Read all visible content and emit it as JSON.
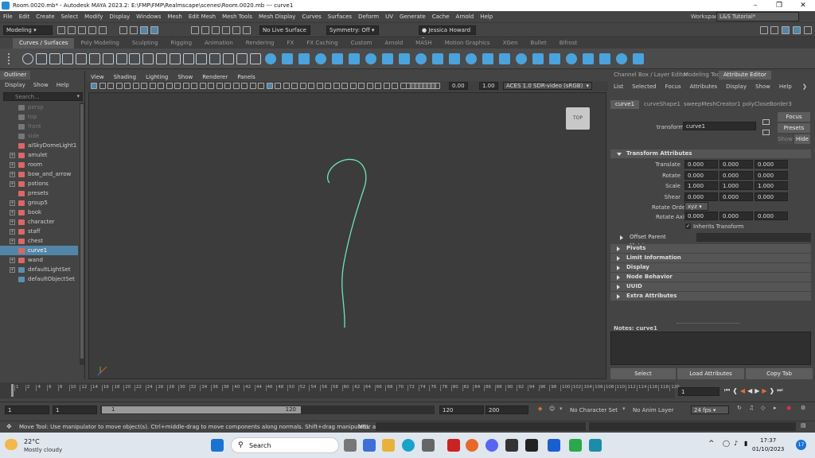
{
  "window": {
    "title": "Room.0020.mb* - Autodesk MAYA 2023.2: E:\\FMP\\FMP\\Realmscape\\scenes\\Room.0020.mb  ---  curve1"
  },
  "menubar": {
    "items": [
      "File",
      "Edit",
      "Create",
      "Select",
      "Modify",
      "Display",
      "Windows",
      "Mesh",
      "Edit Mesh",
      "Mesh Tools",
      "Mesh Display",
      "Curves",
      "Surfaces",
      "Deform",
      "UV",
      "Generate",
      "Cache",
      "Arnold",
      "Help"
    ],
    "workspace_label": "Workspace:",
    "workspace_value": "L&S Tutorial*"
  },
  "statusline": {
    "mode": "Modeling",
    "live_surface": "No Live Surface",
    "symmetry": "Symmetry: Off",
    "user": "Jessica Howard"
  },
  "shelf_tabs": [
    "Curves / Surfaces",
    "Poly Modeling",
    "Sculpting",
    "Rigging",
    "Animation",
    "Rendering",
    "FX",
    "FX Caching",
    "Custom",
    "Arnold",
    "MASH",
    "Motion Graphics",
    "XGen",
    "Bullet",
    "Bifrost"
  ],
  "outliner": {
    "title": "Outliner",
    "menu": [
      "Display",
      "Show",
      "Help"
    ],
    "search_placeholder": "Search...",
    "items": [
      {
        "label": "persp",
        "expand": false,
        "dim": true
      },
      {
        "label": "top",
        "expand": false,
        "dim": true
      },
      {
        "label": "front",
        "expand": false,
        "dim": true
      },
      {
        "label": "side",
        "expand": false,
        "dim": true
      },
      {
        "label": "aiSkyDomeLight1",
        "expand": false,
        "dim": false
      },
      {
        "label": "amulet",
        "expand": true,
        "dim": false
      },
      {
        "label": "room",
        "expand": true,
        "dim": false
      },
      {
        "label": "bow_and_arrow",
        "expand": true,
        "dim": false
      },
      {
        "label": "potions",
        "expand": true,
        "dim": false
      },
      {
        "label": "presets",
        "expand": false,
        "dim": false
      },
      {
        "label": "group5",
        "expand": true,
        "dim": false
      },
      {
        "label": "book",
        "expand": true,
        "dim": false
      },
      {
        "label": "character",
        "expand": true,
        "dim": false
      },
      {
        "label": "staff",
        "expand": true,
        "dim": false
      },
      {
        "label": "chest",
        "expand": true,
        "dim": false
      },
      {
        "label": "curve1",
        "expand": false,
        "dim": false,
        "selected": true
      },
      {
        "label": "wand",
        "expand": true,
        "dim": false
      },
      {
        "label": "defaultLightSet",
        "expand": true,
        "dim": false
      },
      {
        "label": "defaultObjectSet",
        "expand": false,
        "dim": false
      }
    ]
  },
  "viewport": {
    "menu": [
      "View",
      "Shading",
      "Lighting",
      "Show",
      "Renderer",
      "Panels"
    ],
    "exposure": "0.00",
    "gamma": "1.00",
    "color_space": "ACES 1.0 SDR-video (sRGB)",
    "view_cube": "TOP"
  },
  "attribute_editor": {
    "panel_tabs": [
      "Channel Box / Layer Editor",
      "Modeling Toolkit",
      "Attribute Editor"
    ],
    "menu": [
      "List",
      "Selected",
      "Focus",
      "Attributes",
      "Display",
      "Show",
      "Help"
    ],
    "node_tabs": [
      "curve1",
      "curveShape1",
      "sweepMeshCreator1",
      "polyCloseBorder3"
    ],
    "transform_label": "transform:",
    "transform_value": "curve1",
    "buttons": {
      "focus": "Focus",
      "presets": "Presets",
      "show": "Show",
      "hide": "Hide"
    },
    "section_transform": "Transform Attributes",
    "attrs": [
      {
        "label": "Translate",
        "v": [
          "0.000",
          "0.000",
          "0.000"
        ]
      },
      {
        "label": "Rotate",
        "v": [
          "0.000",
          "0.000",
          "0.000"
        ]
      },
      {
        "label": "Scale",
        "v": [
          "1.000",
          "1.000",
          "1.000"
        ]
      },
      {
        "label": "Shear",
        "v": [
          "0.000",
          "0.000",
          "0.000"
        ]
      }
    ],
    "rotate_order_label": "Rotate Order",
    "rotate_order_value": "xyz",
    "rotate_axis": {
      "label": "Rotate Axis",
      "v": [
        "0.000",
        "0.000",
        "0.000"
      ]
    },
    "inherits_transform": "Inherits Transform",
    "offset_parent_matrix": "Offset Parent Matrix",
    "sections": [
      "Pivots",
      "Limit Information",
      "Display",
      "Node Behavior",
      "UUID",
      "Extra Attributes"
    ],
    "notes_label": "Notes:  curve1",
    "bottom_buttons": [
      "Select",
      "Load Attributes",
      "Copy Tab"
    ]
  },
  "timeline": {
    "ticks": [
      "1",
      "2",
      "4",
      "6",
      "8",
      "10",
      "12",
      "14",
      "16",
      "18",
      "20",
      "22",
      "24",
      "26",
      "28",
      "30",
      "32",
      "34",
      "36",
      "38",
      "40",
      "42",
      "44",
      "46",
      "48",
      "50",
      "52",
      "54",
      "56",
      "58",
      "60",
      "62",
      "64",
      "66",
      "68",
      "70",
      "72",
      "74",
      "76",
      "78",
      "80",
      "82",
      "84",
      "86",
      "88",
      "90",
      "92",
      "94",
      "96",
      "98",
      "100",
      "102",
      "104",
      "106",
      "108",
      "110",
      "112",
      "114",
      "116",
      "118",
      "120"
    ],
    "current_frame": "1"
  },
  "rangebar": {
    "start": "1",
    "anim_start": "1",
    "range_start": "1",
    "range_end": "120",
    "anim_end": "120",
    "end": "200",
    "character_set": "No Character Set",
    "anim_layer": "No Anim Layer",
    "fps": "24 fps"
  },
  "helpline": {
    "text": "Move Tool: Use manipulator to move object(s). Ctrl+middle-drag to move components along normals. Shift+drag manipulator axis or plane handles to ext",
    "mel": "MEL"
  },
  "taskbar": {
    "temp": "22°C",
    "weather": "Mostly cloudy",
    "search": "Search",
    "time": "17:37",
    "date": "01/10/2023",
    "notif": "17",
    "lang": "^"
  }
}
